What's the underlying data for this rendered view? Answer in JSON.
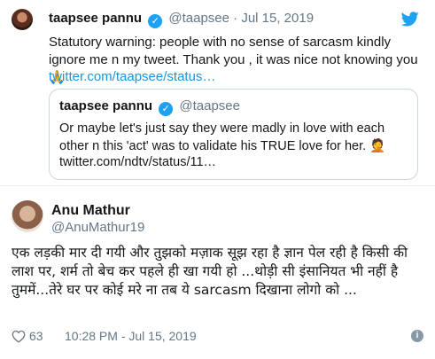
{
  "parent_tweet": {
    "name": "taapsee pannu",
    "handle": "@taapsee",
    "date": "· Jul 15, 2019",
    "text": "Statutory warning: people with no sense of sarcasm kindly ignore me n my tweet. Thank you , it was nice not knowing you 🙏",
    "link": "twitter.com/taapsee/status…",
    "quoted": {
      "name": "taapsee pannu",
      "handle": "@taapsee",
      "text": "Or maybe let's just say they were madly in love with each other n this 'act' was to validate his TRUE love for her. 🤦",
      "link": "twitter.com/ndtv/status/11…"
    }
  },
  "reply": {
    "name": "Anu Mathur",
    "handle": "@AnuMathur19",
    "text": "एक लड़की मार दी गयी और तुझको मज़ाक सूझ रहा है ज्ञान पेल रही है किसी की लाश पर, शर्म तो बेच कर पहले ही खा गयी हो ...थोड़ी सी इंसानियत भी नहीं है तुममें...तेरे घर पर कोई मरे ना तब ये sarcasm दिखाना लोगो को ...",
    "likes": "63",
    "timestamp": "10:28 PM - Jul 15, 2019"
  },
  "icons": {
    "verified": "verified-badge-icon",
    "brand": "twitter-bird-icon",
    "like": "heart-icon",
    "info": "info-icon"
  },
  "colors": {
    "brand_blue": "#1da1f2",
    "link_blue": "#1b95e0",
    "muted_gray": "#657786"
  }
}
